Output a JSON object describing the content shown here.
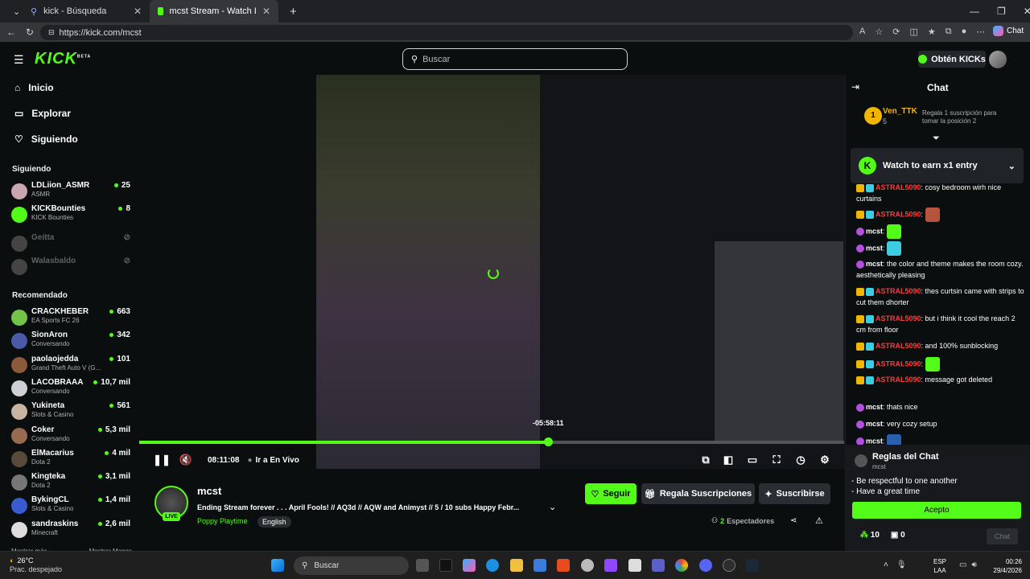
{
  "browser": {
    "tabs": [
      {
        "label": "kick - Búsqueda"
      },
      {
        "label": "mcst Stream - Watch Live on Kick"
      }
    ],
    "url": "https://kick.com/mcst",
    "chat_button": "Chat"
  },
  "header": {
    "logo": "KICK",
    "beta": "BETA",
    "search_placeholder": "Buscar",
    "kicks_button": "Obtén KICKs"
  },
  "nav": [
    {
      "label": "Inicio"
    },
    {
      "label": "Explorar"
    },
    {
      "label": "Siguiendo"
    }
  ],
  "following_title": "Siguiendo",
  "following": [
    {
      "name": "LDLiion_ASMR",
      "category": "ASMR",
      "viewers": "25"
    },
    {
      "name": "KICKBounties",
      "category": "KICK Bounties",
      "viewers": "8"
    },
    {
      "name": "Geitta",
      "category": "",
      "viewers": ""
    },
    {
      "name": "Walasbaldo",
      "category": "",
      "viewers": ""
    }
  ],
  "recommended_title": "Recomendado",
  "recommended": [
    {
      "name": "CRACKHEBER",
      "category": "EA Sports FC 26",
      "viewers": "663"
    },
    {
      "name": "SionAron",
      "category": "Conversando",
      "viewers": "342"
    },
    {
      "name": "paolaojedda",
      "category": "Grand Theft Auto V (G...",
      "viewers": "101"
    },
    {
      "name": "LACOBRAAA",
      "category": "Conversando",
      "viewers": "10,7 mil"
    },
    {
      "name": "Yukineta",
      "category": "Slots & Casino",
      "viewers": "561"
    },
    {
      "name": "Coker",
      "category": "Conversando",
      "viewers": "5,3 mil"
    },
    {
      "name": "ElMacarius",
      "category": "Dota 2",
      "viewers": "4 mil"
    },
    {
      "name": "Kingteka",
      "category": "Dota 2",
      "viewers": "3,1 mil"
    },
    {
      "name": "BykingCL",
      "category": "Slots & Casino",
      "viewers": "1,4 mil"
    },
    {
      "name": "sandraskins",
      "category": "Minecraft",
      "viewers": "2,6 mil"
    }
  ],
  "sidebar_footer": {
    "show_more": "Mostrar más",
    "show_less": "Mostrar Menos"
  },
  "player": {
    "behind_live": "-05:58:11",
    "elapsed": "08:11:08",
    "go_live": "Ir a En Vivo",
    "progress": 0.58
  },
  "stream": {
    "name": "mcst",
    "live": "LIVE",
    "title": "Ending Stream forever . . . April Fools! // AQ3d // AQW and Animyst  // 5 / 10 subs Happy Febr...",
    "category": "Poppy Playtime",
    "language": "English",
    "follow": "Seguir",
    "gift": "Regala Suscripciones",
    "subscribe": "Suscribirse",
    "viewers_count": "2",
    "viewers_label": "Espectadores"
  },
  "chat": {
    "title": "Chat",
    "top_gifter": {
      "rank": "1",
      "name": "Ven_TTK",
      "count": "5",
      "cta": "Regala 1 suscripción para tomar la posición 2"
    },
    "watch_banner": "Watch to earn x1 entry",
    "messages": [
      {
        "user": "ASTRAL5090",
        "text": "cosy bedroom wirh nice curtains",
        "kind": "red"
      },
      {
        "user": "ASTRAL5090",
        "text": "",
        "kind": "red",
        "emote": "#b5533c"
      },
      {
        "user": "mcst",
        "text": "",
        "kind": "white",
        "emote": "#53fc18"
      },
      {
        "user": "mcst",
        "text": "",
        "kind": "white",
        "emote": "#3ccde0"
      },
      {
        "user": "mcst",
        "text": "the color and theme makes the room cozy. aesthetically pleasing",
        "kind": "white"
      },
      {
        "user": "ASTRAL5090",
        "text": "thes curtsin came with strips to cut them dhorter",
        "kind": "red"
      },
      {
        "user": "ASTRAL5090",
        "text": "but i think it cool the reach 2 cm from floor",
        "kind": "red"
      },
      {
        "user": "ASTRAL5090",
        "text": "and 100% sunblocking",
        "kind": "red"
      },
      {
        "user": "ASTRAL5090",
        "text": "",
        "kind": "red",
        "emote": "#53fc18"
      },
      {
        "user": "ASTRAL5090",
        "text": "message got deleted",
        "kind": "red"
      },
      {
        "user": "mcst",
        "text": "thats nice",
        "kind": "white"
      },
      {
        "user": "mcst",
        "text": "very cozy setup",
        "kind": "white"
      },
      {
        "user": "mcst",
        "text": "",
        "kind": "white",
        "emote": "#2a5fb0"
      }
    ],
    "rules": {
      "title": "Reglas del Chat",
      "channel": "mcst",
      "items": [
        "- Be respectful to one another",
        "- Have a great time"
      ],
      "accept": "Acepto"
    },
    "kicks": "10",
    "gifts": "0",
    "send": "Chat"
  },
  "taskbar": {
    "temp": "26°C",
    "weather": "Prac. despejado",
    "search": "Buscar",
    "lang1": "ESP",
    "lang2": "LAA",
    "time": "00:26",
    "date": "29/4/2026"
  },
  "colors": {
    "brand": "#53fc18",
    "bg": "#0b0e0f",
    "gold": "#f2b600",
    "chat_red": "#ff3a3a"
  }
}
